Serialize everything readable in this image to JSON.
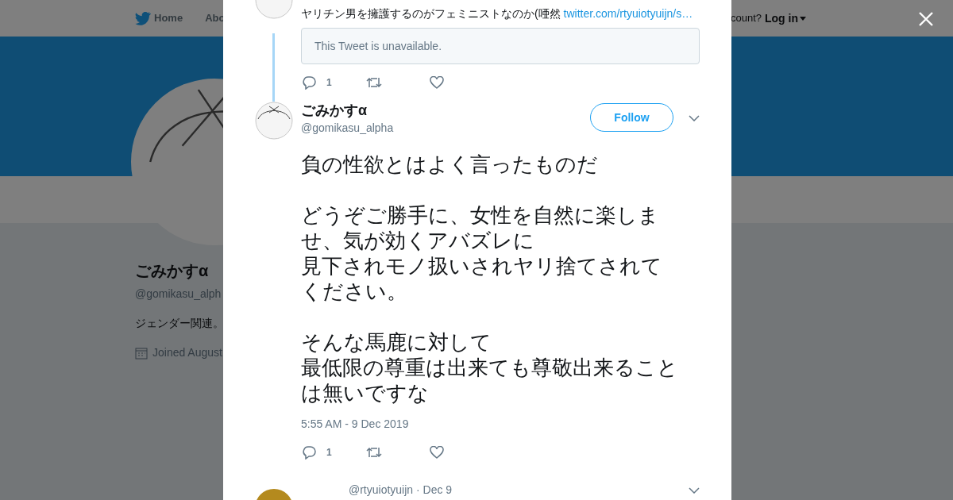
{
  "background_page": {
    "nav": {
      "items": [
        {
          "label": "Home",
          "selected": false
        },
        {
          "label": "Abo",
          "selected": false
        }
      ],
      "account_prompt": "count?",
      "login": "Log in"
    },
    "profile": {
      "name": "ごみかすα",
      "handle": "@gomikasu_alph",
      "bio": "ジェンダー関連。",
      "joined": "Joined August"
    }
  },
  "modal": {
    "thread": [
      {
        "text": "ヤリチン男を擁護するのがフェミニストなのか(唖然",
        "link": "twitter.com/rtyuiotyuijn/s…",
        "quoted": "This Tweet is unavailable.",
        "actions": {
          "replies": "1"
        }
      }
    ],
    "tweet": {
      "name": "ごみかすα",
      "handle": "@gomikasu_alpha",
      "follow": "Follow",
      "paragraphs": [
        [
          "負の性欲とはよく言ったものだ"
        ],
        [
          "どうぞご勝手に、女性を自然に楽しませ、気が効くアバズレに",
          "見下されモノ扱いされヤリ捨てされてください。"
        ],
        [
          "そんな馬鹿に対して",
          "最低限の尊重は出来ても尊敬出来ることは無いですな"
        ]
      ],
      "timestamp": "5:55 AM - 9 Dec 2019",
      "actions": {
        "replies": "1"
      }
    },
    "replies": [
      {
        "meta": "@rtyuiotyuijn · Dec 9"
      }
    ]
  }
}
